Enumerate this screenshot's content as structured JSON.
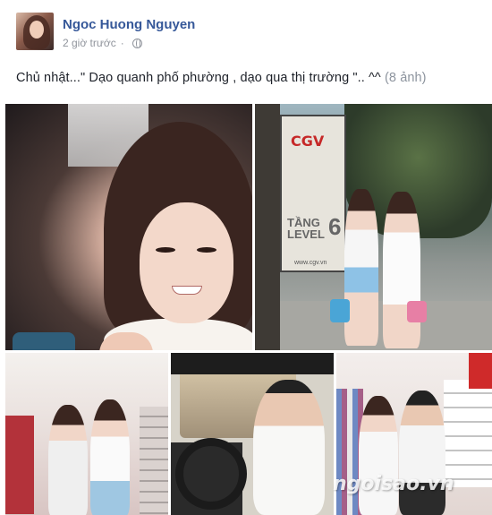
{
  "post": {
    "author": "Ngoc Huong Nguyen",
    "time": "2 giờ trước",
    "caption": "Chủ nhật...\" Dạo quanh phố phường , dạo qua thị trường \".. ^^",
    "photo_count": "(8 ảnh)"
  },
  "photos": {
    "p2_sign_brand": "CGV",
    "p2_sign_level_text": "TẦNG LEVEL",
    "p2_sign_level_number": "6",
    "p2_sign_url": "www.cgv.vn"
  },
  "watermark": "ngoisao.vn",
  "icons": {
    "privacy": "globe-icon"
  },
  "colors": {
    "author_link": "#365899",
    "meta_text": "#90949c"
  }
}
